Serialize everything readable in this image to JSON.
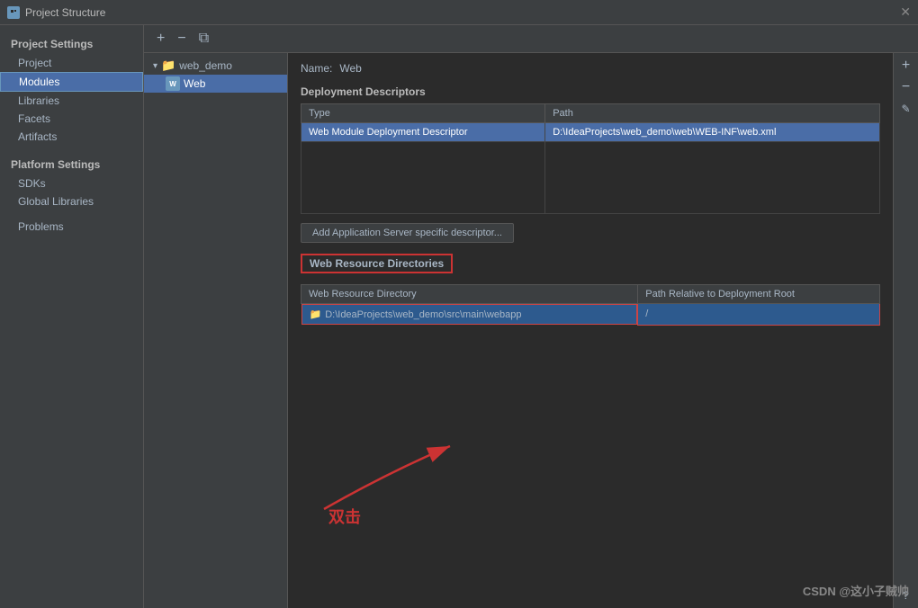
{
  "titleBar": {
    "title": "Project Structure",
    "closeLabel": "✕"
  },
  "toolbar": {
    "addLabel": "+",
    "removeLabel": "−",
    "copyLabel": "⧉"
  },
  "sidebar": {
    "projectSettingsLabel": "Project Settings",
    "items": [
      {
        "id": "project",
        "label": "Project"
      },
      {
        "id": "modules",
        "label": "Modules",
        "active": true
      },
      {
        "id": "libraries",
        "label": "Libraries"
      },
      {
        "id": "facets",
        "label": "Facets"
      },
      {
        "id": "artifacts",
        "label": "Artifacts"
      }
    ],
    "platformSettingsLabel": "Platform Settings",
    "platformItems": [
      {
        "id": "sdks",
        "label": "SDKs"
      },
      {
        "id": "global-libraries",
        "label": "Global Libraries"
      }
    ],
    "problemsLabel": "Problems"
  },
  "tree": {
    "projectName": "web_demo",
    "moduleName": "Web"
  },
  "nameField": {
    "label": "Name:",
    "value": "Web"
  },
  "deploymentDescriptors": {
    "sectionLabel": "Deployment Descriptors",
    "columns": {
      "type": "Type",
      "path": "Path"
    },
    "rows": [
      {
        "type": "Web Module Deployment Descriptor",
        "path": "D:\\IdeaProjects\\web_demo\\web\\WEB-INF\\web.xml",
        "selected": true
      }
    ]
  },
  "addDescriptorButton": "Add Application Server specific descriptor...",
  "webResourceDirectories": {
    "sectionLabel": "Web Resource Directories",
    "columns": {
      "directory": "Web Resource Directory",
      "path": "Path Relative to Deployment Root"
    },
    "rows": [
      {
        "directory": "D:\\IdeaProjects\\web_demo\\src\\main\\webapp",
        "path": "/",
        "highlighted": true
      }
    ]
  },
  "rightSidebar": {
    "addLabel": "+",
    "removeLabel": "−",
    "editLabel": "✎",
    "helpLabel": "?"
  },
  "annotation": {
    "text": "双击",
    "color": "#cc3333"
  },
  "watermark": "CSDN @这小子贼帅"
}
